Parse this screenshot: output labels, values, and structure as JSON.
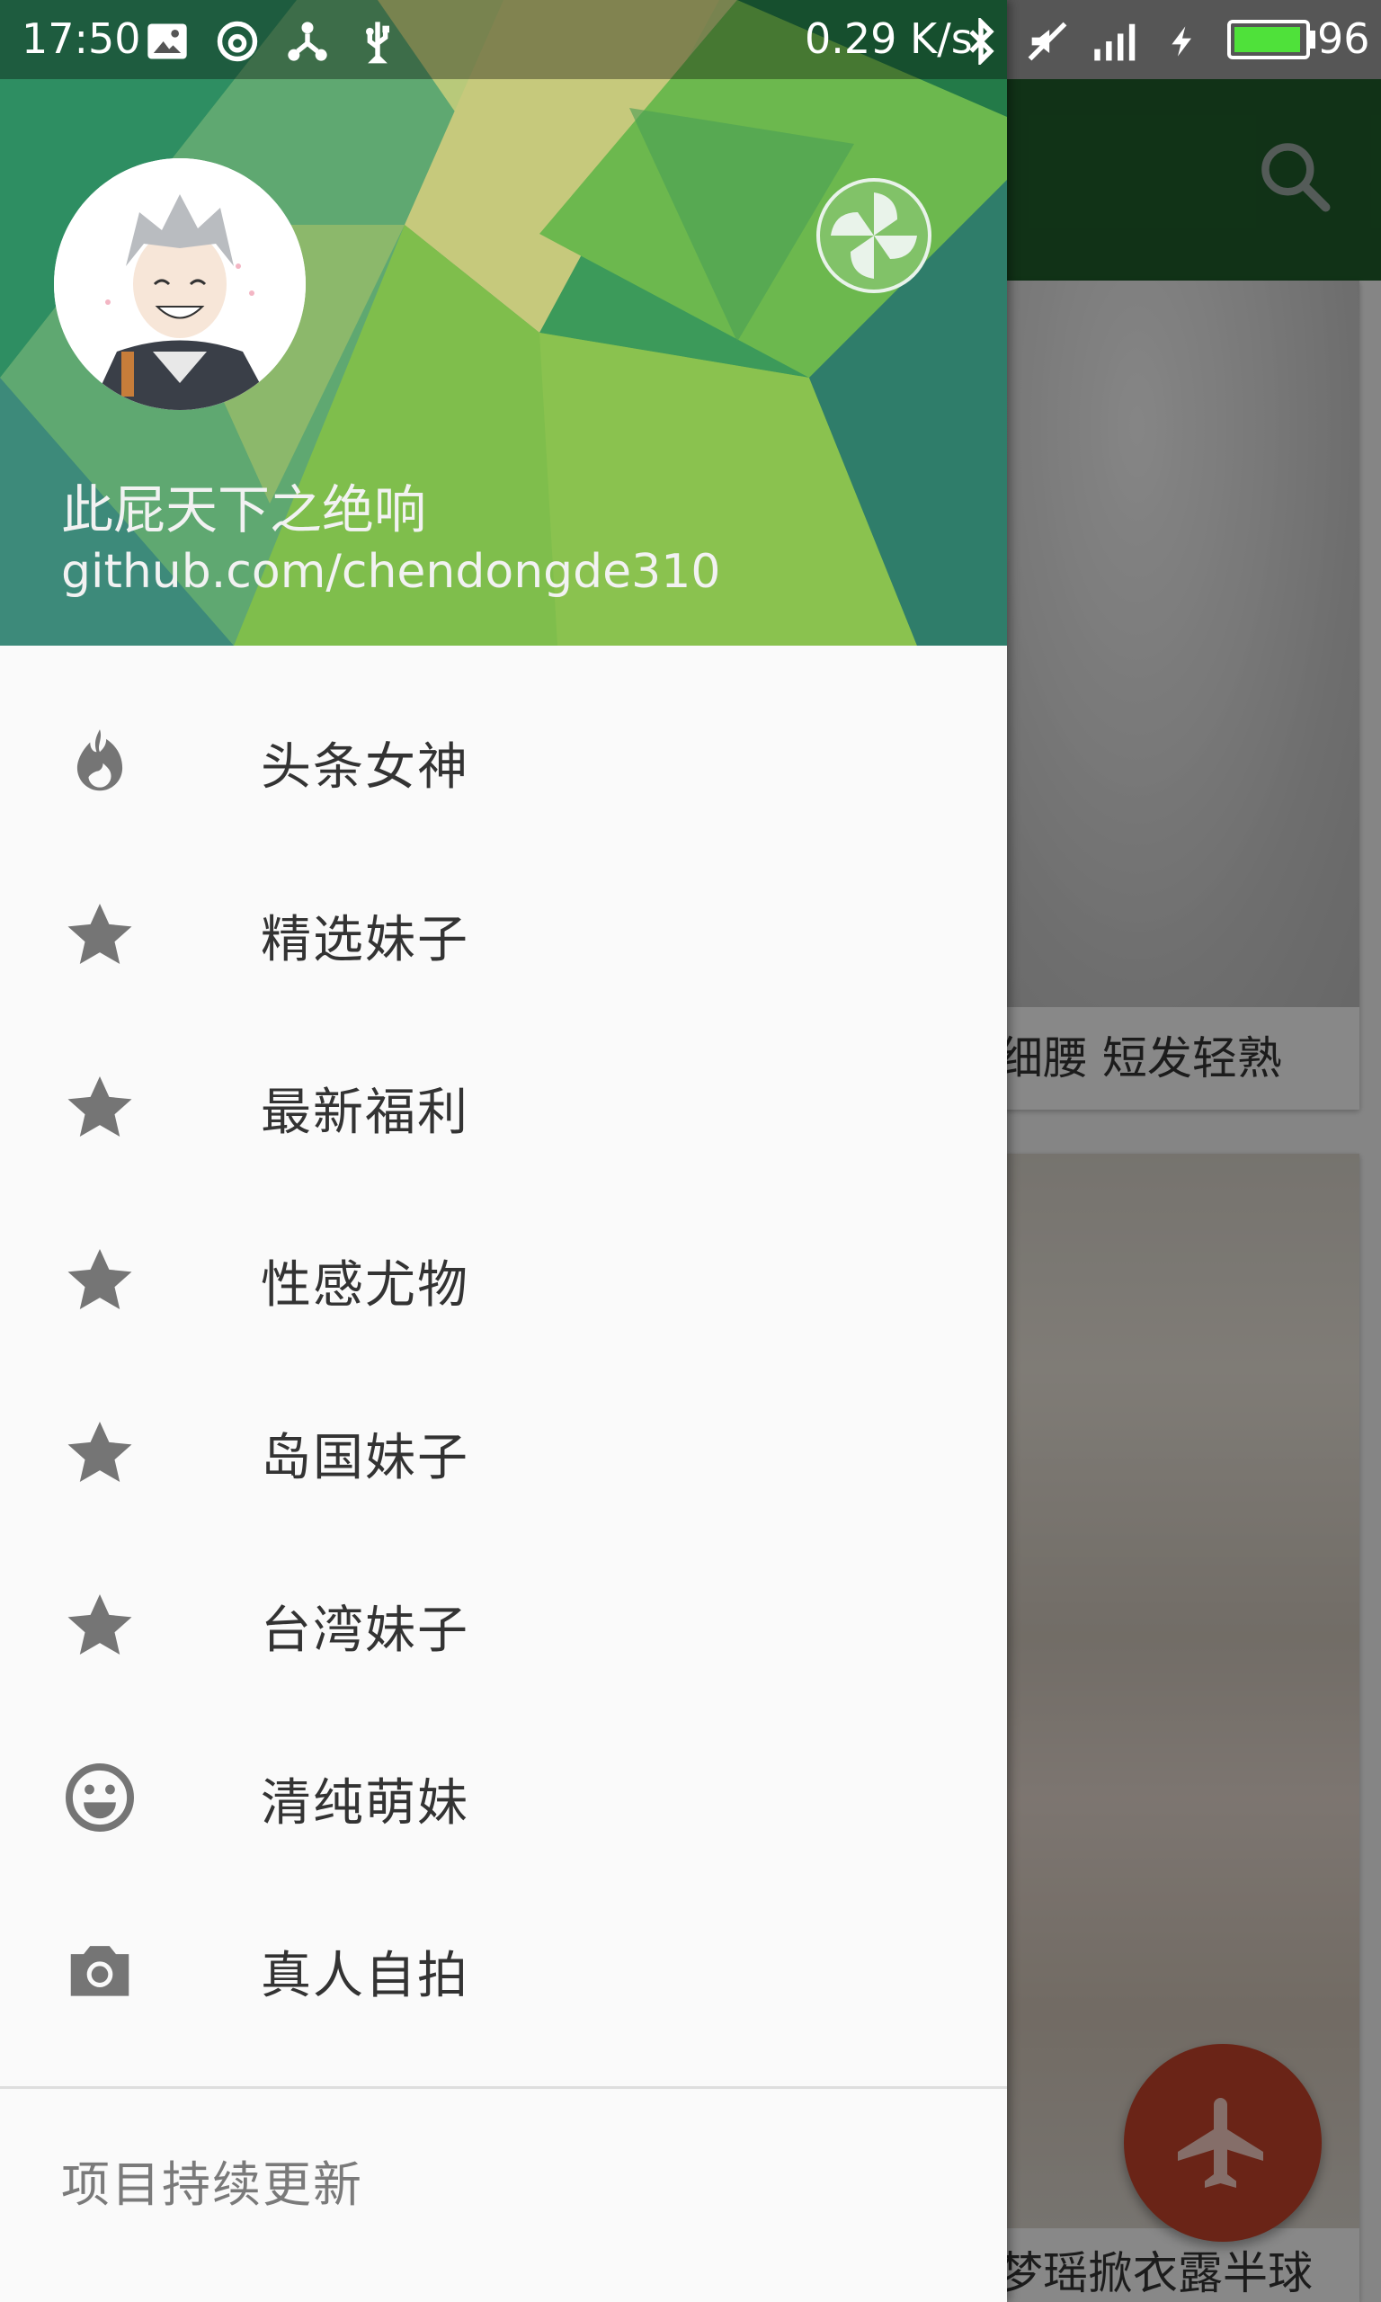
{
  "status_bar": {
    "time": "17:50",
    "net_speed": "0.29 K/s",
    "battery_level": "96"
  },
  "background": {
    "card1_caption": "细腰  短发轻熟",
    "card2_caption": "梦瑶掀衣露半球"
  },
  "drawer": {
    "user_name": "此屁天下之绝响",
    "user_link": "github.com/chendongde310",
    "menu": [
      {
        "label": "头条女神",
        "icon": "flame-icon"
      },
      {
        "label": "精选妹子",
        "icon": "star-icon"
      },
      {
        "label": "最新福利",
        "icon": "star-icon"
      },
      {
        "label": "性感尤物",
        "icon": "star-icon"
      },
      {
        "label": "岛国妹子",
        "icon": "star-icon"
      },
      {
        "label": "台湾妹子",
        "icon": "star-icon"
      },
      {
        "label": "清纯萌妹",
        "icon": "smiley-icon"
      },
      {
        "label": "真人自拍",
        "icon": "camera-icon"
      }
    ],
    "footer": "项目持续更新"
  },
  "colors": {
    "toolbar": "#1f5c2a",
    "fab": "#c2432a",
    "battery": "#4fe13a"
  }
}
